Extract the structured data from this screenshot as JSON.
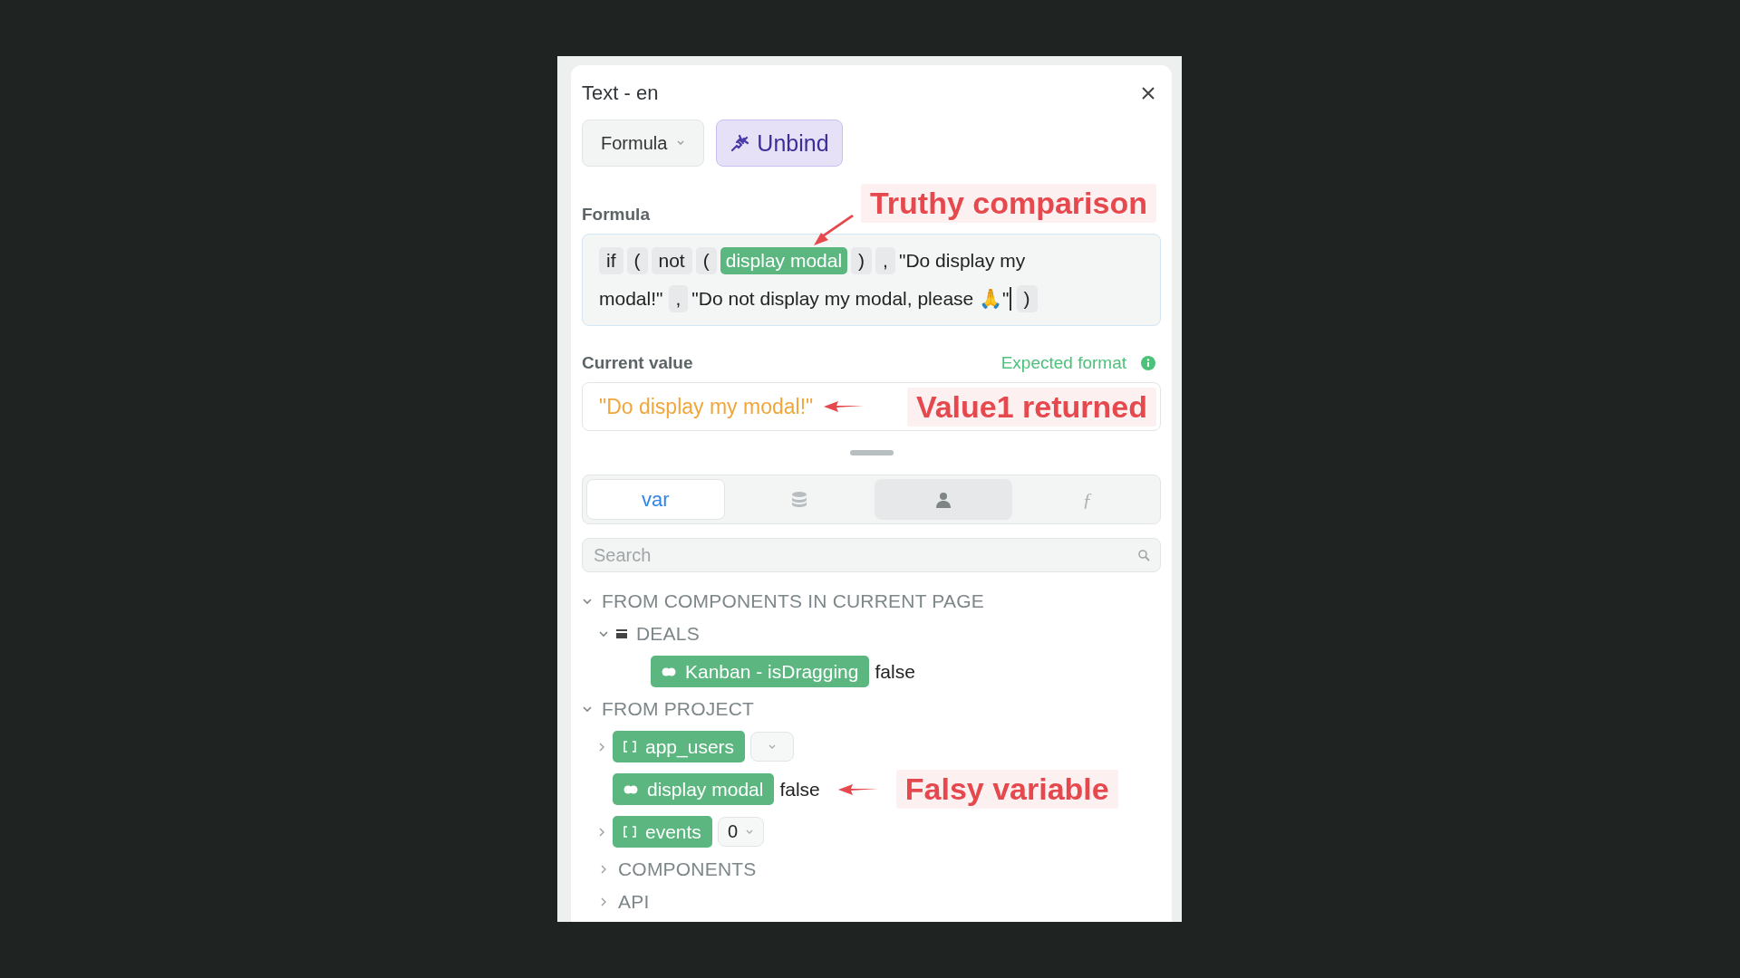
{
  "panel": {
    "title": "Text - en",
    "mode_button": "Formula",
    "unbind_button": "Unbind"
  },
  "formula": {
    "label": "Formula",
    "annotation": "Truthy comparison",
    "tokens": [
      {
        "kind": "op",
        "text": "if"
      },
      {
        "kind": "op",
        "text": "("
      },
      {
        "kind": "op",
        "text": "not"
      },
      {
        "kind": "op",
        "text": "("
      },
      {
        "kind": "var",
        "text": "display modal"
      },
      {
        "kind": "op",
        "text": ")"
      },
      {
        "kind": "op",
        "text": ","
      },
      {
        "kind": "text",
        "text": "\"Do display my"
      },
      {
        "kind": "text",
        "text": "modal!\""
      },
      {
        "kind": "op",
        "text": ","
      },
      {
        "kind": "text",
        "text": "\"Do not display my modal, please 🙏\"",
        "caret": true
      },
      {
        "kind": "op",
        "text": ")"
      }
    ]
  },
  "current_value": {
    "label": "Current value",
    "format_link": "Expected format",
    "value": "\"Do display my modal!\"",
    "annotation": "Value1 returned"
  },
  "tabs": [
    {
      "kind": "text",
      "label": "var",
      "selected": true,
      "highlighted": false
    },
    {
      "kind": "database",
      "selected": false,
      "highlighted": false
    },
    {
      "kind": "person",
      "selected": false,
      "highlighted": true
    },
    {
      "kind": "text",
      "label": "ƒ",
      "selected": false,
      "highlighted": false
    }
  ],
  "search": {
    "placeholder": "Search"
  },
  "tree": [
    {
      "kind": "section",
      "label": "FROM COMPONENTS IN CURRENT PAGE",
      "expanded": true,
      "children": [
        {
          "kind": "group",
          "label": "DEALS",
          "expanded": true,
          "children": [
            {
              "kind": "boolean_variable",
              "label": "Kanban - isDragging",
              "value": "false"
            }
          ]
        }
      ]
    },
    {
      "kind": "section",
      "label": "FROM PROJECT",
      "expanded": true,
      "children": [
        {
          "kind": "array_variable",
          "label": "app_users",
          "expanded": false,
          "dropdown": true
        },
        {
          "kind": "boolean_variable",
          "label": "display modal",
          "value": "false",
          "annotation": "Falsy variable"
        },
        {
          "kind": "array_variable",
          "label": "events",
          "expanded": false,
          "dropdown": true,
          "dropdown_value": "0"
        },
        {
          "kind": "section",
          "label": "COMPONENTS",
          "expanded": false
        },
        {
          "kind": "section",
          "label": "API",
          "expanded": false
        }
      ]
    }
  ]
}
